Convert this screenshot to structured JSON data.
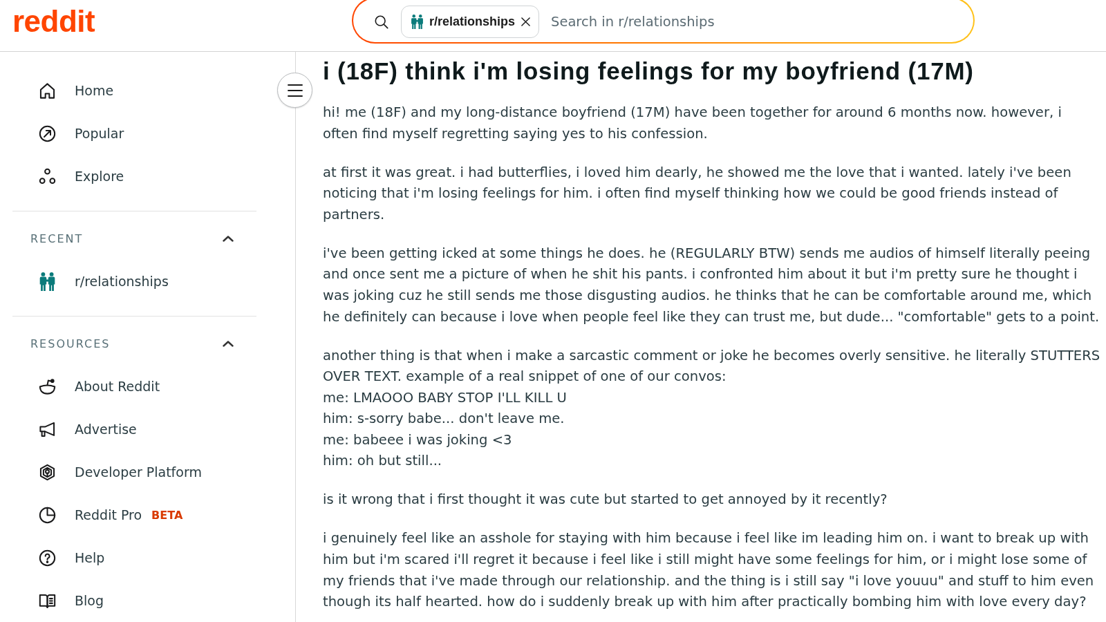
{
  "header": {
    "logo": "reddit",
    "search": {
      "community": "r/relationships",
      "placeholder": "Search in r/relationships"
    }
  },
  "sidebar": {
    "nav": [
      {
        "label": "Home"
      },
      {
        "label": "Popular"
      },
      {
        "label": "Explore"
      }
    ],
    "sections": [
      {
        "title": "RECENT",
        "expanded": true,
        "items": [
          {
            "label": "r/relationships"
          }
        ]
      },
      {
        "title": "RESOURCES",
        "expanded": true,
        "items": [
          {
            "label": "About Reddit"
          },
          {
            "label": "Advertise"
          },
          {
            "label": "Developer Platform"
          },
          {
            "label": "Reddit Pro",
            "badge": "BETA"
          },
          {
            "label": "Help"
          },
          {
            "label": "Blog"
          }
        ]
      }
    ]
  },
  "post": {
    "title": "i (18F) think i'm losing feelings for my boyfriend (17M)",
    "paragraphs": [
      "hi! me (18F) and my long-distance boyfriend (17M) have been together for around 6 months now. however, i often find myself regretting saying yes to his confession.",
      "at first it was great. i had butterflies, i loved him dearly, he showed me the love that i wanted. lately i've been noticing that i'm losing feelings for him. i often find myself thinking how we could be good friends instead of partners.",
      "i've been getting icked at some things he does. he (REGULARLY BTW) sends me audios of himself literally peeing and once sent me a picture of when he shit his pants. i confronted him about it but i'm pretty sure he thought i was joking cuz he still sends me those disgusting audios. he thinks that he can be comfortable around me, which he definitely can because i love when people feel like they can trust me, but dude... \"comfortable\" gets to a point.",
      "another thing is that when i make a sarcastic comment or joke he becomes overly sensitive. he literally STUTTERS OVER TEXT. example of a real snippet of one of our convos:\nme: LMAOOO BABY STOP I'LL KILL U\nhim: s-sorry babe... don't leave me.\nme: babeee i was joking <3\nhim: oh but still...",
      "is it wrong that i first thought it was cute but started to get annoyed by it recently?",
      "i genuinely feel like an asshole for staying with him because i feel like im leading him on. i want to break up with him but i'm scared i'll regret it because i feel like i still might have some feelings for him, or i might lose some of my friends that i've made through our relationship. and the thing is i still say \"i love youuu\" and stuff to him even though its half hearted. how do i suddenly break up with him after practically bombing him with love every day?"
    ]
  }
}
